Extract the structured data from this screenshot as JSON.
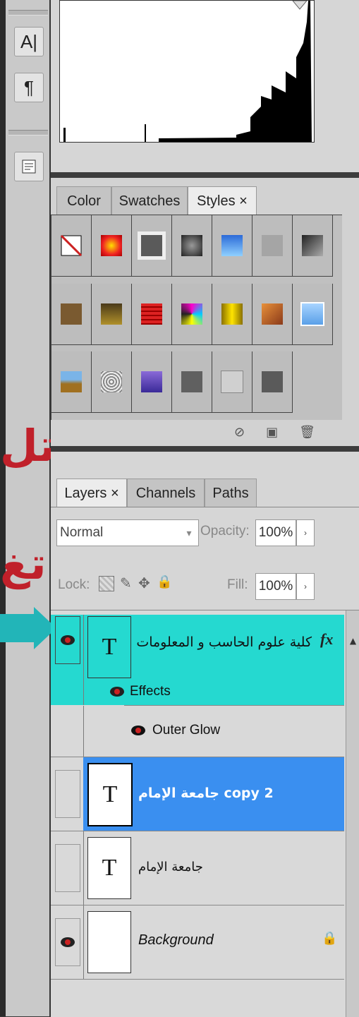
{
  "tools": {
    "character_glyph": "A|",
    "paragraph_glyph": "¶"
  },
  "side_text": {
    "line1": "تل",
    "line2": "تغ"
  },
  "styles_panel": {
    "tabs": [
      {
        "label": "Color"
      },
      {
        "label": "Swatches"
      },
      {
        "label": "Styles ×"
      }
    ]
  },
  "layers_panel": {
    "tabs": [
      {
        "label": "Layers ×"
      },
      {
        "label": "Channels"
      },
      {
        "label": "Paths"
      }
    ],
    "blend_mode": "Normal",
    "opacity_label": "Opacity:",
    "opacity_value": "100%",
    "lock_label": "Lock:",
    "fill_label": "Fill:",
    "fill_value": "100%",
    "layers": [
      {
        "name": "كلية علوم الحاسب و المعلومات",
        "thumb": "T",
        "fx": "fx"
      },
      {
        "name": "Effects"
      },
      {
        "name": "Outer Glow"
      },
      {
        "name": "جامعة الإمام copy 2",
        "thumb": "T"
      },
      {
        "name": "جامعة الإمام",
        "thumb": "T"
      },
      {
        "name": "Background"
      }
    ]
  },
  "colors": {
    "selected_teal": "#25d9d0",
    "selected_blue": "#3a8ff0",
    "arabic_red": "#c0202a"
  }
}
